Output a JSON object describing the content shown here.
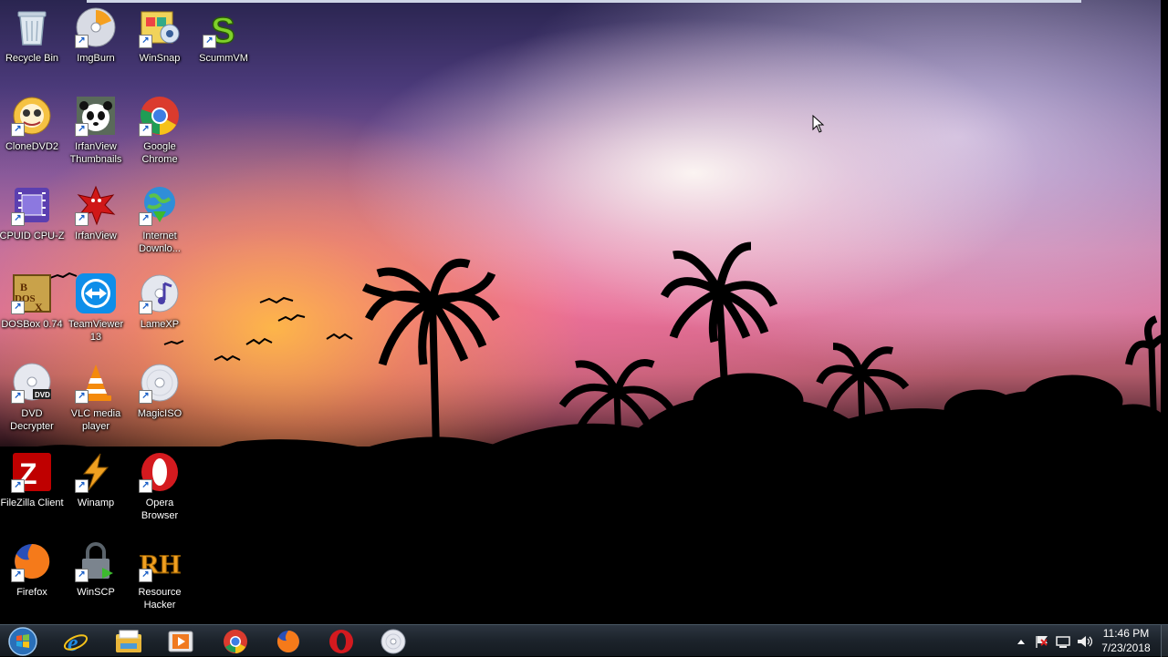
{
  "desktop": {
    "icons": [
      {
        "label": "Recycle Bin",
        "icon": "recycle-bin-icon"
      },
      {
        "label": "ImgBurn",
        "icon": "imgburn-icon"
      },
      {
        "label": "WinSnap",
        "icon": "winsnap-icon"
      },
      {
        "label": "ScummVM",
        "icon": "scummvm-icon"
      },
      {
        "label": "CloneDVD2",
        "icon": "clonedvd-icon"
      },
      {
        "label": "IrfanView Thumbnails",
        "icon": "irfanview-thumbnails-icon"
      },
      {
        "label": "Google Chrome",
        "icon": "chrome-icon"
      },
      {
        "label": "CPUID CPU-Z",
        "icon": "cpuz-icon"
      },
      {
        "label": "IrfanView",
        "icon": "irfanview-icon"
      },
      {
        "label": "Internet Downlo...",
        "icon": "internet-download-manager-icon"
      },
      {
        "label": "DOSBox 0.74",
        "icon": "dosbox-icon"
      },
      {
        "label": "TeamViewer 13",
        "icon": "teamviewer-icon"
      },
      {
        "label": "LameXP",
        "icon": "lamexp-icon"
      },
      {
        "label": "DVD Decrypter",
        "icon": "dvd-decrypter-icon"
      },
      {
        "label": "VLC media player",
        "icon": "vlc-icon"
      },
      {
        "label": "MagicISO",
        "icon": "magiciso-icon"
      },
      {
        "label": "FileZilla Client",
        "icon": "filezilla-icon"
      },
      {
        "label": "Winamp",
        "icon": "winamp-icon"
      },
      {
        "label": "Opera Browser",
        "icon": "opera-icon"
      },
      {
        "label": "Firefox",
        "icon": "firefox-icon"
      },
      {
        "label": "WinSCP",
        "icon": "winscp-icon"
      },
      {
        "label": "Resource Hacker",
        "icon": "resource-hacker-icon"
      }
    ]
  },
  "taskbar": {
    "start": {
      "icon": "windows-start-icon"
    },
    "pinned": [
      {
        "icon": "internet-explorer-icon"
      },
      {
        "icon": "file-explorer-icon"
      },
      {
        "icon": "media-player-icon"
      },
      {
        "icon": "chrome-icon"
      },
      {
        "icon": "firefox-icon"
      },
      {
        "icon": "opera-icon"
      },
      {
        "icon": "dvd-disc-icon"
      }
    ],
    "tray": {
      "icons": [
        "show-hidden-icons-icon",
        "action-center-flag-icon",
        "network-icon",
        "volume-icon"
      ],
      "time": "11:46 PM",
      "date": "7/23/2018"
    }
  }
}
